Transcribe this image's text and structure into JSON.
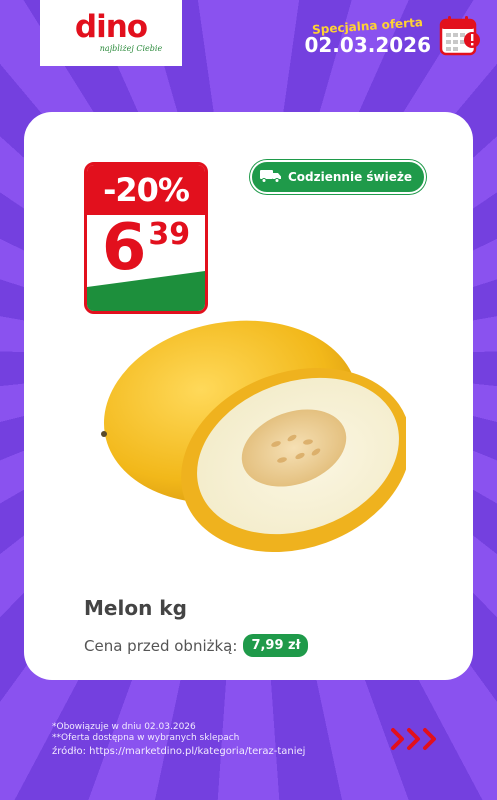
{
  "brand": {
    "logo": "dino",
    "tagline": "najbliżej Ciebie"
  },
  "offer": {
    "label": "Specjalna oferta",
    "date": "02.03.2026",
    "icon": "calendar-alert-icon"
  },
  "price_tag": {
    "discount": "-20%",
    "price_int": "6",
    "price_dec": "39"
  },
  "badge": {
    "label": "Codziennie świeże",
    "icon": "delivery-truck-icon"
  },
  "product": {
    "name": "Melon kg",
    "prev_price_label": "Cena przed obniżką:",
    "prev_price_value": "7,99 zł"
  },
  "footer": {
    "note1": "*Obowiązuje w dniu 02.03.2026",
    "note2": "**Oferta dostępna w wybranych sklepach",
    "source": "źródło: https://marketdino.pl/kategoria/teraz-taniej",
    "next_icon": "triple-chevron-right-icon"
  },
  "colors": {
    "background": "#7b3fe4",
    "brand_red": "#e2101d",
    "brand_green": "#1f9a4a",
    "offer_yellow": "#ffd233"
  }
}
